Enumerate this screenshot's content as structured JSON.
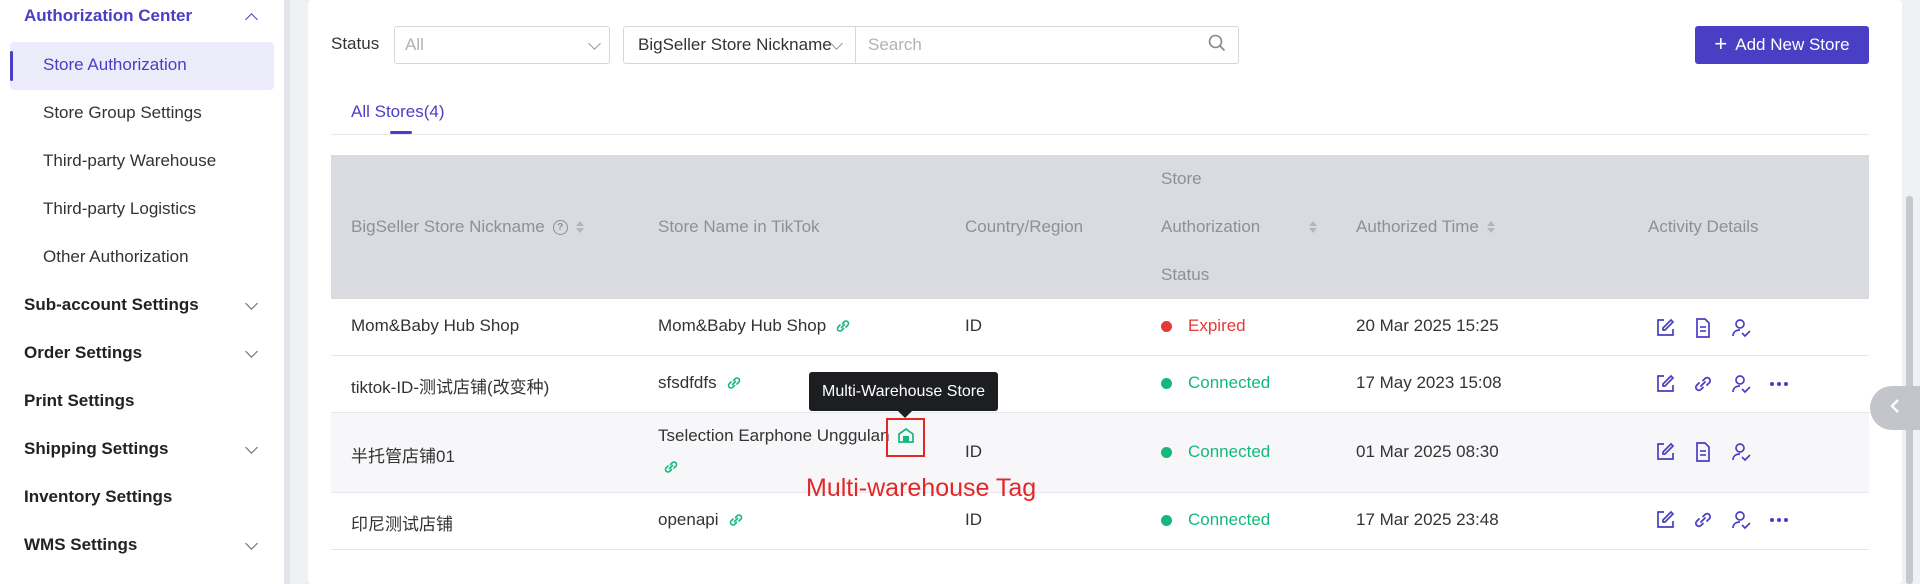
{
  "sidebar": {
    "active_group": "Authorization Center",
    "active_item": "Store Authorization",
    "items": [
      "Store Group Settings",
      "Third-party Warehouse",
      "Third-party Logistics",
      "Other Authorization"
    ],
    "groups": [
      "Sub-account Settings",
      "Order Settings",
      "Print Settings",
      "Shipping Settings",
      "Inventory Settings",
      "WMS Settings"
    ]
  },
  "filters": {
    "status_label": "Status",
    "status_value": "All",
    "search_type": "BigSeller Store Nickname",
    "search_placeholder": "Search"
  },
  "add_button": "Add New Store",
  "tabs": {
    "all": "All Stores(4)"
  },
  "table": {
    "headers": {
      "nickname": "BigSeller Store Nickname",
      "store_name": "Store Name in TikTok",
      "country": "Country/Region",
      "auth_status_1": "Store",
      "auth_status_2": "Authorization",
      "auth_status_3": "Status",
      "time": "Authorized Time",
      "activity": "Activity Details"
    },
    "rows": [
      {
        "nickname": "Mom&Baby Hub Shop",
        "store_name": "Mom&Baby Hub Shop",
        "country": "ID",
        "status": "Expired",
        "time": "20 Mar 2025 15:25"
      },
      {
        "nickname": "tiktok-ID-测试店铺(改变种)",
        "store_name": "sfsdfdfs",
        "country": "",
        "status": "Connected",
        "time": "17 May 2023 15:08"
      },
      {
        "nickname": "半托管店铺01",
        "store_name": "Tselection Earphone Unggulan",
        "country": "ID",
        "status": "Connected",
        "time": "01 Mar 2025 08:30"
      },
      {
        "nickname": "印尼测试店铺",
        "store_name": "openapi",
        "country": "ID",
        "status": "Connected",
        "time": "17 Mar 2025 23:48"
      }
    ]
  },
  "tooltip": "Multi-Warehouse Store",
  "annotation": "Multi-warehouse Tag",
  "colors": {
    "accent": "#4a3ec4",
    "connected": "#14b87a",
    "expired": "#e83838",
    "annotation": "#e32626"
  }
}
